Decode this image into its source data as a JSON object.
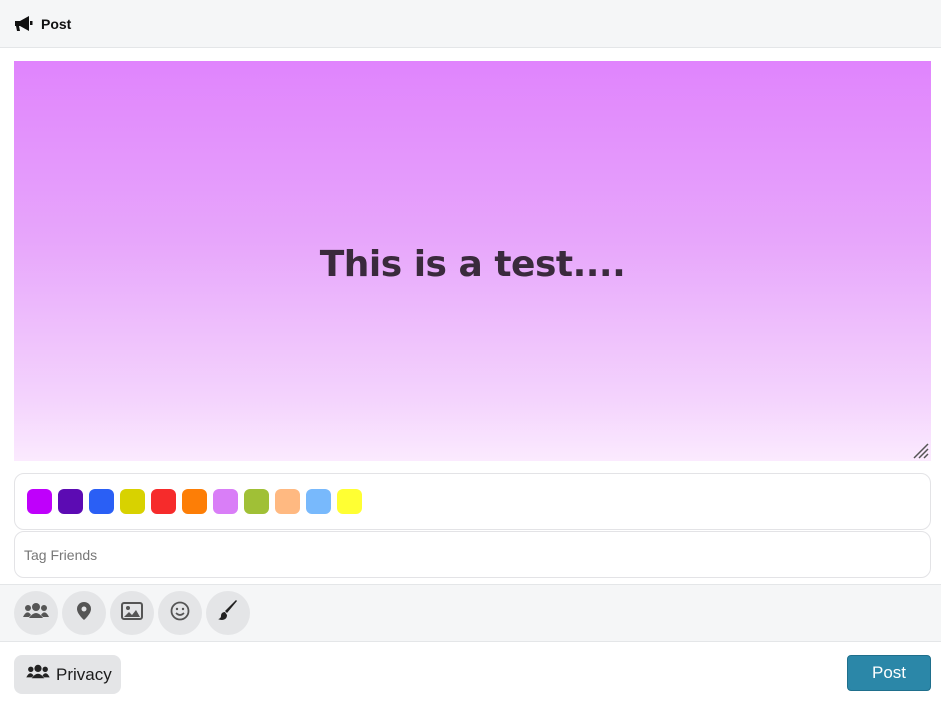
{
  "header": {
    "title": "Post",
    "icon": "megaphone-icon"
  },
  "post": {
    "text": "This is a test...."
  },
  "background_colors": [
    "#bf00fb",
    "#5c0bb3",
    "#2a5ff5",
    "#d8d200",
    "#f62b2b",
    "#fd7e06",
    "#d97ef7",
    "#a0c036",
    "#ffb981",
    "#78b9fc",
    "#ffff33"
  ],
  "tag_friends": {
    "placeholder": "Tag Friends"
  },
  "toolbar": {
    "tools": [
      {
        "name": "tag-friends-tool",
        "icon": "users-icon"
      },
      {
        "name": "location-tool",
        "icon": "map-pin-icon"
      },
      {
        "name": "photo-tool",
        "icon": "image-icon"
      },
      {
        "name": "emoji-tool",
        "icon": "smile-icon"
      },
      {
        "name": "background-tool",
        "icon": "paintbrush-icon"
      }
    ]
  },
  "footer": {
    "privacy_label": "Privacy",
    "post_label": "Post"
  }
}
